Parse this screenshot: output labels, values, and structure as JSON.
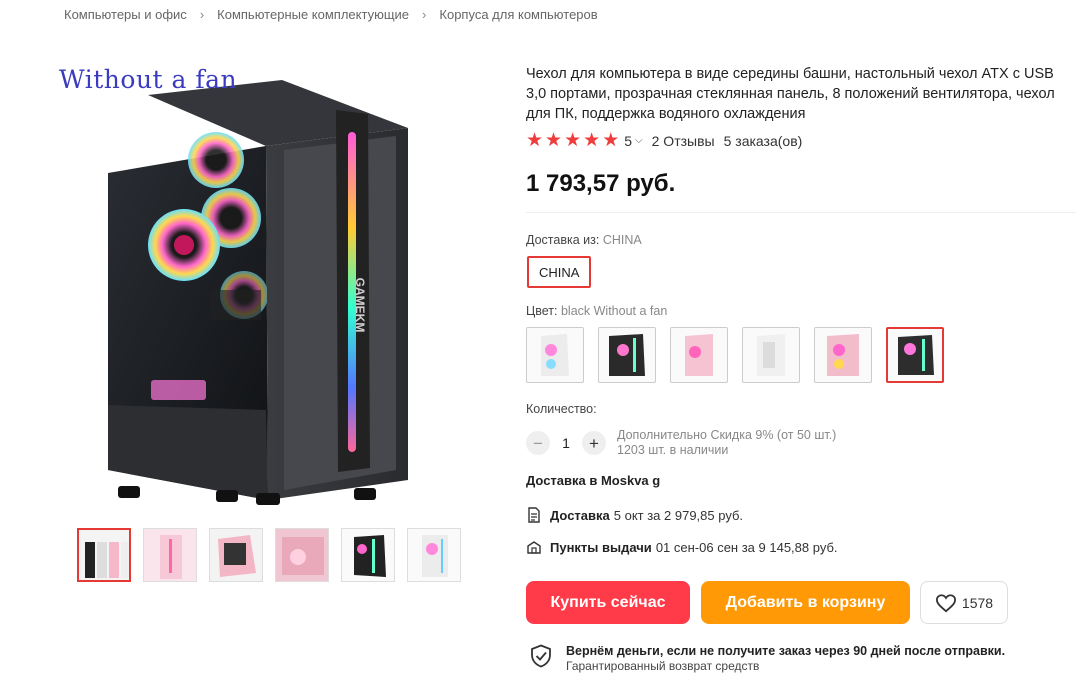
{
  "breadcrumb": [
    "Компьютеры и офис",
    "Компьютерные комплектующие",
    "Корпуса для компьютеров"
  ],
  "gallery": {
    "overlay_text": "Without a fan",
    "case_logo": "GAMEKM"
  },
  "product": {
    "title": "Чехол для компьютера в виде середины башни, настольный чехол ATX с USB 3,0 портами, прозрачная стеклянная панель, 8 положений вентилятора, чехол для ПК, поддержка водяного охлаждения",
    "rating": "5",
    "reviews": "2 Отзывы",
    "orders": "5 заказа(ов)",
    "price": "1 793,57 руб."
  },
  "shipping": {
    "label": "Доставка из:",
    "value": "CHINA",
    "option": "CHINA"
  },
  "color": {
    "label": "Цвет:",
    "value": "black Without a fan"
  },
  "quantity": {
    "label": "Количество:",
    "value": "1",
    "minus": "−",
    "plus": "+",
    "discount": "Дополнительно Скидка 9% (от 50 шт.)",
    "stock": "1203 шт. в наличии"
  },
  "delivery": {
    "title": "Доставка в Moskva g",
    "courier_label": "Доставка",
    "courier_detail": "5 окт за 2 979,85 руб.",
    "pickup_label": "Пункты выдачи",
    "pickup_detail": "01 сен-06 сен за 9 145,88 руб."
  },
  "actions": {
    "buy": "Купить сейчас",
    "cart": "Добавить в корзину",
    "wishlist_count": "1578"
  },
  "guarantee": {
    "line1": "Вернём деньги, если не получите заказ через 90 дней после отправки.",
    "line2": "Гарантированный возврат средств"
  },
  "colors": {
    "accent": "#e53935",
    "buy": "#ff3a49",
    "cart": "#ff9a06",
    "star": "#ef3d3d"
  }
}
